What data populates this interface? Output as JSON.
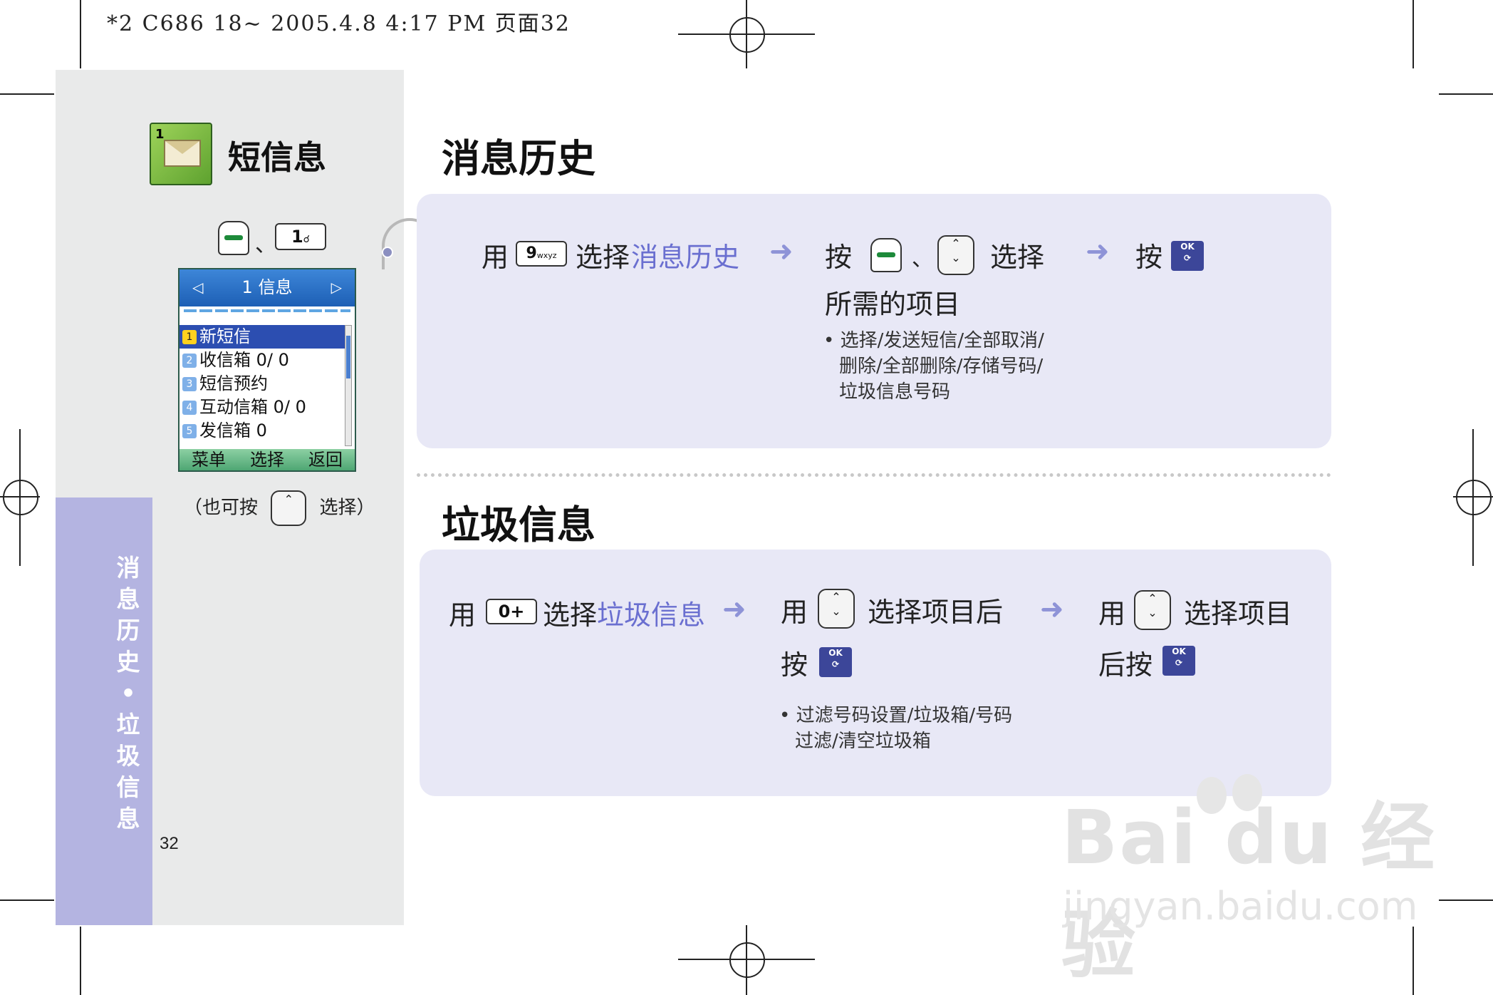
{
  "print_header": "*2 C686 18~ 2005.4.8 4:17 PM 页面32",
  "sidebar": {
    "app_title": "短信息",
    "app_icon_number": "1",
    "key_send": "send-key",
    "separator": "、",
    "key_1_label": "1",
    "screen": {
      "header": "1 信息",
      "items": [
        {
          "num": "1",
          "label": "新短信"
        },
        {
          "num": "2",
          "label": "收信箱  0/ 0"
        },
        {
          "num": "3",
          "label": "短信预约"
        },
        {
          "num": "4",
          "label": "互动信箱  0/ 0"
        },
        {
          "num": "5",
          "label": "发信箱  0"
        }
      ],
      "softkeys": [
        "菜单",
        "选择",
        "返回"
      ]
    },
    "alt_note_prefix": "（也可按",
    "alt_note_suffix": "选择）",
    "vertical_tab": "消息历史•垃圾信息",
    "page_number": "32"
  },
  "section1": {
    "title": "消息历史",
    "step1": {
      "prefix": "用",
      "key": "9",
      "key_sub": "wxyz",
      "verb": "选择",
      "target": "消息历史"
    },
    "step2": {
      "verb": "按",
      "sep": "、",
      "action": "选择",
      "line2": "所需的项目"
    },
    "step2_bullet": [
      "选择/发送短信/全部取消/",
      "删除/全部删除/存储号码/",
      "垃圾信息号码"
    ],
    "step3": {
      "verb": "按"
    }
  },
  "section2": {
    "title": "垃圾信息",
    "step1": {
      "prefix": "用",
      "key": "0+",
      "verb": "选择",
      "target": "垃圾信息"
    },
    "step2": {
      "prefix": "用",
      "action": "选择项目后",
      "line2": "按"
    },
    "step2_bullet": [
      "过滤号码设置/垃圾箱/号码",
      "过滤/清空垃圾箱"
    ],
    "step3": {
      "prefix": "用",
      "action": "选择项目",
      "line2": "后按"
    }
  },
  "ok_label": "OK",
  "watermark": {
    "brand": "Bai du 经验",
    "url": "jingyan.baidu.com"
  },
  "colors": {
    "accent": "#6a6fd0",
    "panel": "#e8e8f6",
    "sidebar_tab": "#b4b4e1",
    "ok_key": "#3c4699"
  }
}
